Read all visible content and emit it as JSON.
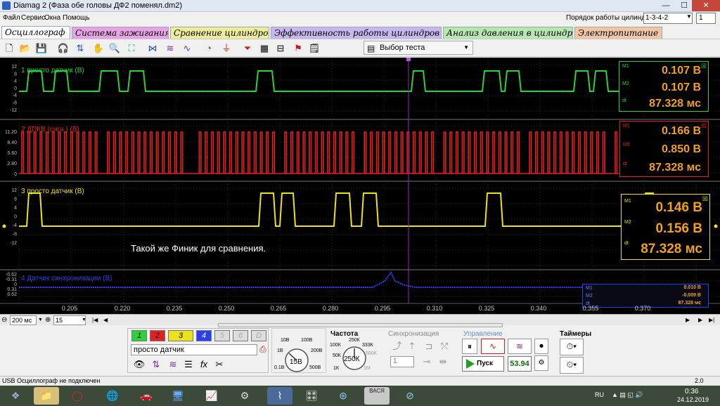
{
  "window": {
    "title": "Diamag 2 (Фаза обе головы ДФ2 поменял.dm2)",
    "minimize": "—",
    "maximize": "☐",
    "close": "✕"
  },
  "menu": [
    "Файл",
    "Сервис",
    "Окна",
    "Помощь"
  ],
  "cylinder_order": {
    "label": "Порядок работы цилиндров",
    "value": "1-3-4-2",
    "count": "1"
  },
  "tabs": [
    {
      "label": "Осциллограф",
      "color": "#ffffff"
    },
    {
      "label": "Система зажигания",
      "color": "#e7a3e6"
    },
    {
      "label": "Сравнение цилиндров",
      "color": "#ecec9a"
    },
    {
      "label": "Эффективность работы цилиндров",
      "color": "#c8b6ef"
    },
    {
      "label": "Анализ давления в цилиндре",
      "color": "#b7e7b0"
    },
    {
      "label": "Электропитание",
      "color": "#f2c5a6"
    }
  ],
  "toolbar": {
    "test_select": "Выбор теста"
  },
  "channels": [
    {
      "label": "1 просто датчик (В)",
      "color": "#2bd33a",
      "scale": [
        "12",
        "8",
        "4",
        "0",
        "-4",
        "-8",
        "-12"
      ],
      "m1": "0.107 В",
      "m2": "0.107 В",
      "dt": "87.328 мс"
    },
    {
      "label": "2 ДПКВ (сигн.) (В)",
      "color": "#e32020",
      "scale": [
        "11.20",
        "8.40",
        "5.60",
        "2.80",
        "0"
      ],
      "m1": "0.166 В",
      "m2": "0.850 В",
      "dt": "87.328 мс"
    },
    {
      "label": "3 просто датчик (В)",
      "color": "#ece21a",
      "scale": [
        "12",
        "8",
        "4",
        "0",
        "-4",
        "-8",
        "-12"
      ],
      "m1": "0.146 В",
      "m2": "0.156 В",
      "dt": "87.328 мс"
    },
    {
      "label": "4 Датчик синхронизации (В)",
      "color": "#2a3ff0",
      "scale": [
        "-0.62",
        "-0.31",
        "0",
        "0.31",
        "0.62"
      ],
      "m1": "0.010 В",
      "m2": "-0.009 В",
      "dt": "87.328 мс"
    }
  ],
  "marker_labels": {
    "m1": "M1",
    "m2": "M2",
    "dt": "dt"
  },
  "time_axis": [
    "0.205",
    "0.220",
    "0.235",
    "0.250",
    "0.265",
    "0.280",
    "0.295",
    "0.310",
    "0.325",
    "0.340",
    "0.355",
    "0.370"
  ],
  "annotation": "Такой же Финик для сравнения.",
  "scrollbar": {
    "timebase": "200 мс",
    "zoom": "15"
  },
  "channel_buttons": [
    "1",
    "2",
    "3",
    "4",
    "5",
    "6",
    "D"
  ],
  "channel_name": "просто датчик",
  "voltage_knob": {
    "value": "15В",
    "ticks": [
      "10В",
      "100В",
      "1В",
      "200В",
      "0.1В",
      "500В"
    ]
  },
  "frequency": {
    "title": "Частота",
    "value": "250К",
    "ticks": [
      "250К",
      "100К",
      "333К",
      "50К",
      "500К",
      "1К",
      "1М"
    ]
  },
  "sync": {
    "title": "Синхронизация",
    "channel": "1"
  },
  "control": {
    "title": "Управление",
    "start": "Пуск",
    "rpm": "53.94"
  },
  "timers": {
    "title": "Таймеры"
  },
  "status": {
    "text": "USB Осциллограф не подключен",
    "version": "2.0"
  },
  "taskbar": {
    "lang": "RU",
    "time": "0:36",
    "date": "24.12.2019"
  }
}
